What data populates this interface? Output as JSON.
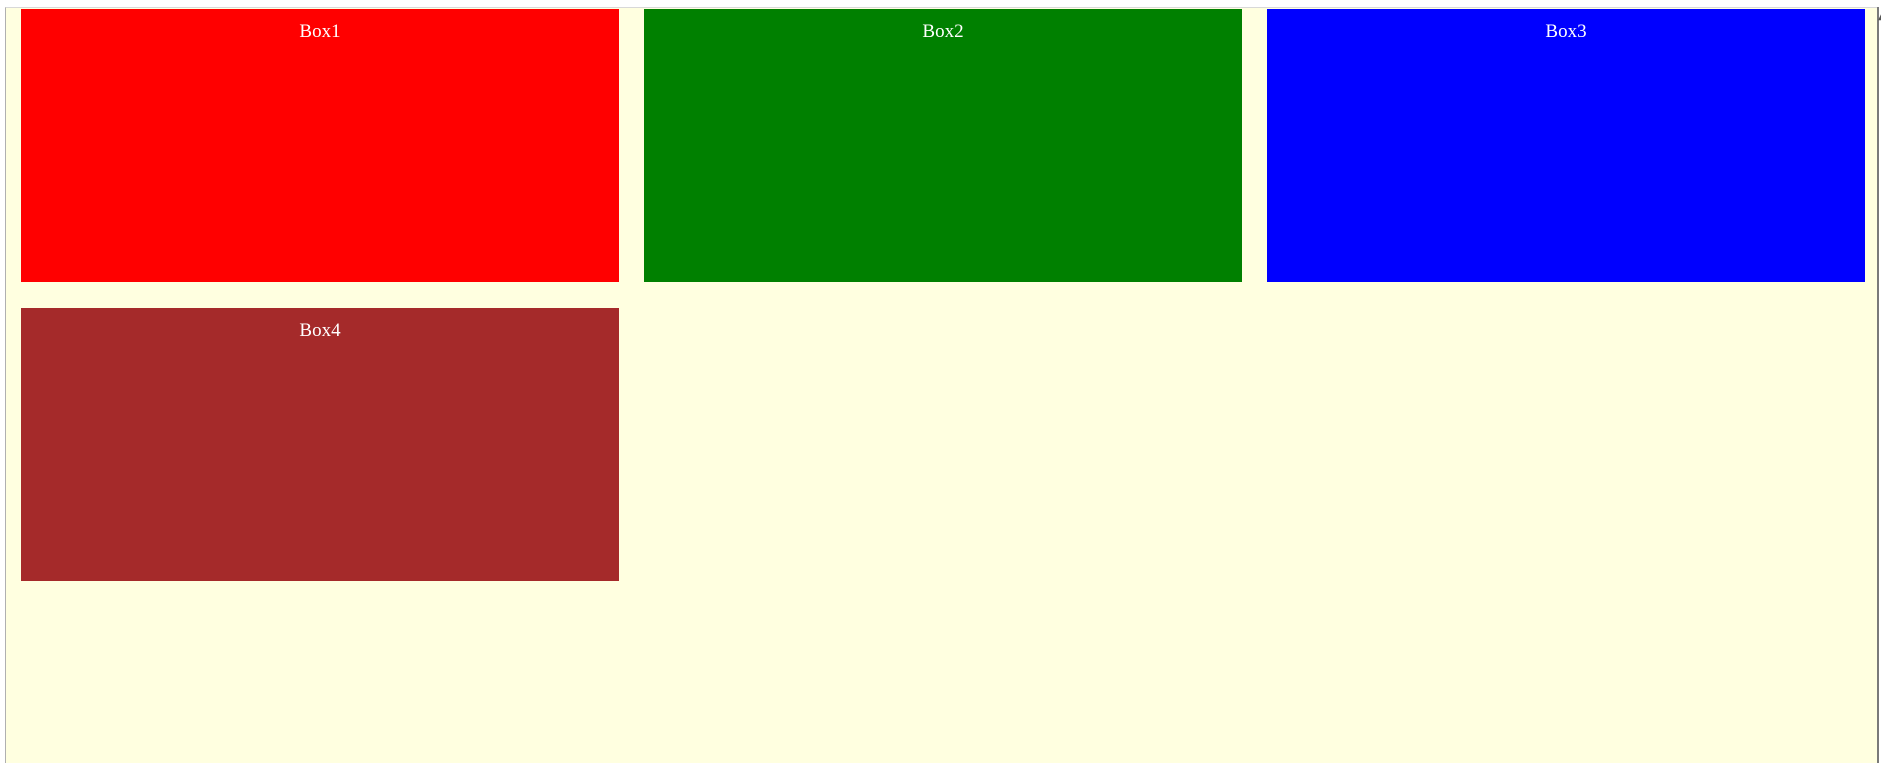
{
  "boxes": [
    {
      "label": "Box1",
      "color": "#ff0000"
    },
    {
      "label": "Box2",
      "color": "#008000"
    },
    {
      "label": "Box3",
      "color": "#0000ff"
    },
    {
      "label": "Box4",
      "color": "#a52a2a"
    }
  ],
  "page": {
    "background": "#ffffe0"
  },
  "scrollbar": {
    "icon": "scroll-up-arrow-icon"
  }
}
